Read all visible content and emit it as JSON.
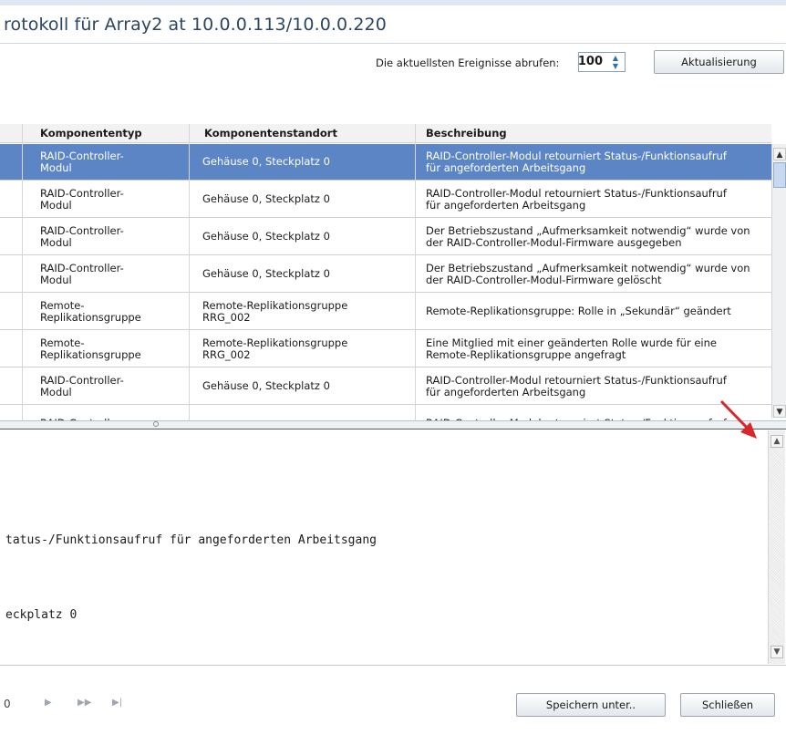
{
  "title": "rotokoll für Array2 at 10.0.0.113/10.0.0.220",
  "toolbar": {
    "fetch_label": "Die aktuellsten Ereignisse abrufen:",
    "count_value": "100",
    "refresh_label": "Aktualisierung"
  },
  "columns": [
    "Komponententyp",
    "Komponentenstandort",
    "Beschreibung"
  ],
  "rows": [
    {
      "type": [
        "RAID-Controller-",
        "Modul"
      ],
      "location": [
        "Gehäuse 0, Steckplatz 0"
      ],
      "desc": [
        "RAID-Controller-Modul retourniert Status-/Funktionsaufruf",
        "für angeforderten Arbeitsgang"
      ],
      "selected": true
    },
    {
      "type": [
        "RAID-Controller-",
        "Modul"
      ],
      "location": [
        "Gehäuse 0, Steckplatz 0"
      ],
      "desc": [
        "RAID-Controller-Modul retourniert Status-/Funktionsaufruf",
        "für angeforderten Arbeitsgang"
      ],
      "selected": false
    },
    {
      "type": [
        "RAID-Controller-",
        "Modul"
      ],
      "location": [
        "Gehäuse 0, Steckplatz 0"
      ],
      "desc": [
        "Der Betriebszustand „Aufmerksamkeit notwendig“ wurde von",
        "der RAID-Controller-Modul-Firmware ausgegeben"
      ],
      "selected": false
    },
    {
      "type": [
        "RAID-Controller-",
        "Modul"
      ],
      "location": [
        "Gehäuse 0, Steckplatz 0"
      ],
      "desc": [
        "Der Betriebszustand „Aufmerksamkeit notwendig“ wurde von",
        "der RAID-Controller-Modul-Firmware gelöscht"
      ],
      "selected": false
    },
    {
      "type": [
        "Remote-",
        "Replikationsgruppe"
      ],
      "location": [
        "Remote-Replikationsgruppe",
        "RRG_002"
      ],
      "desc": [
        "Remote-Replikationsgruppe: Rolle in „Sekundär“ geändert"
      ],
      "selected": false
    },
    {
      "type": [
        "Remote-",
        "Replikationsgruppe"
      ],
      "location": [
        "Remote-Replikationsgruppe",
        "RRG_002"
      ],
      "desc": [
        "Eine Mitglied mit einer geänderten Rolle wurde für eine",
        "Remote-Replikationsgruppe angefragt"
      ],
      "selected": false
    },
    {
      "type": [
        "RAID-Controller-",
        "Modul"
      ],
      "location": [
        "Gehäuse 0, Steckplatz 0"
      ],
      "desc": [
        "RAID-Controller-Modul retourniert Status-/Funktionsaufruf",
        "für angeforderten Arbeitsgang"
      ],
      "selected": false
    },
    {
      "type": [
        "RAID-Controller-"
      ],
      "location": [
        ""
      ],
      "desc": [
        "RAID-Controller-Modul retourniert Status-/Funktionsaufruf"
      ],
      "selected": false
    }
  ],
  "detail": {
    "line1": "tatus-/Funktionsaufruf für angeforderten Arbeitsgang",
    "line2": "eckplatz 0"
  },
  "footer": {
    "pager_fragment": "0",
    "save_label": "Speichern unter..",
    "close_label": "Schließen"
  },
  "colors": {
    "selection": "#5b85c5",
    "title_text": "#2a4566",
    "annotation_arrow": "#d9262b"
  },
  "icons": [
    "spin-up-icon",
    "spin-down-icon",
    "scroll-up-icon",
    "scroll-down-icon",
    "play-icon",
    "fast-forward-icon",
    "skip-end-icon",
    "annotation-arrow-icon"
  ]
}
